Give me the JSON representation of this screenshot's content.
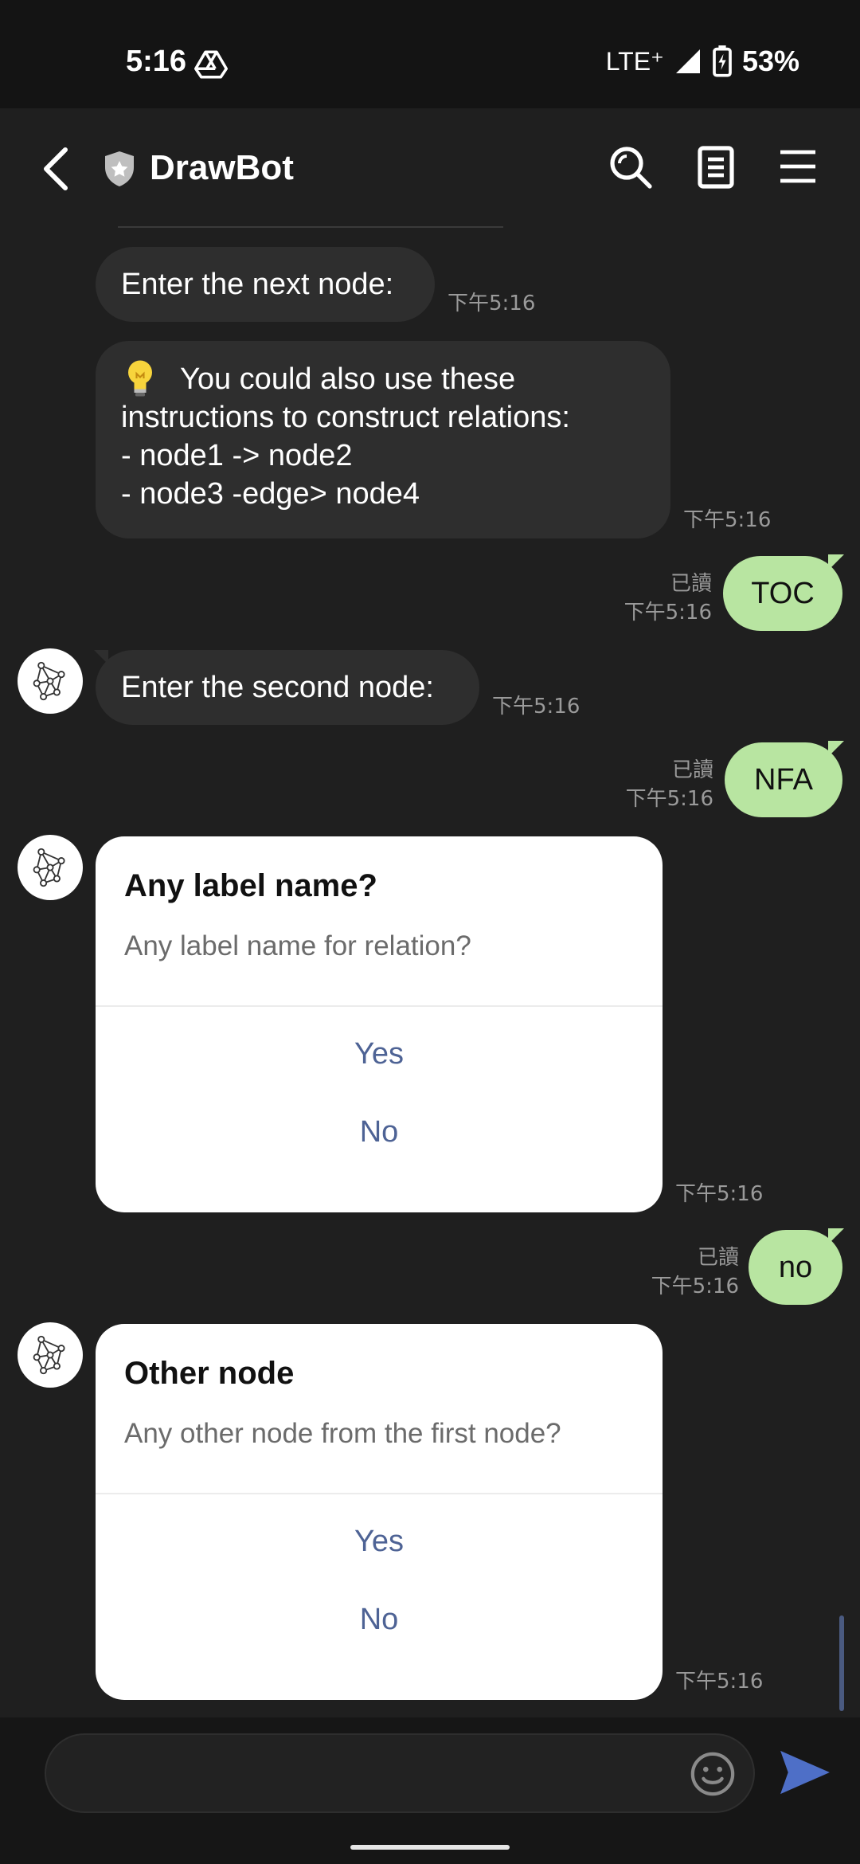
{
  "status_bar": {
    "time": "5:16",
    "network": "LTE⁺",
    "battery": "53%",
    "icons": [
      "drive-icon",
      "signal-icon",
      "battery-charging-icon"
    ]
  },
  "header": {
    "title": "DrawBot",
    "icons": [
      "back-icon",
      "shield-icon",
      "search-icon",
      "notes-icon",
      "menu-icon"
    ]
  },
  "messages": {
    "m1": {
      "text": "Enter the next node:",
      "time": "下午5:16"
    },
    "m2": {
      "line1": "You could also use these",
      "line2": "instructions to construct relations:",
      "line3": "- node1 -> node2",
      "line4": "- node3 -edge> node4",
      "time": "下午5:16",
      "icon": "lightbulb-icon"
    },
    "m3": {
      "text": "TOC",
      "read": "已讀",
      "time": "下午5:16"
    },
    "m4": {
      "text": "Enter the second node:",
      "time": "下午5:16"
    },
    "m5": {
      "text": "NFA",
      "read": "已讀",
      "time": "下午5:16"
    },
    "card1": {
      "title": "Any label name?",
      "text": "Any label name for relation?",
      "yes": "Yes",
      "no": "No",
      "time": "下午5:16"
    },
    "m6": {
      "text": "no",
      "read": "已讀",
      "time": "下午5:16"
    },
    "card2": {
      "title": "Other node",
      "text": "Any other node from the first node?",
      "yes": "Yes",
      "no": "No",
      "time": "下午5:16"
    }
  },
  "input": {
    "placeholder": "",
    "icons": [
      "emoji-icon",
      "send-icon"
    ]
  },
  "colors": {
    "background": "#1f1f1f",
    "incoming_bubble": "#2e2e2e",
    "outgoing_bubble": "#b8e5a1",
    "card_button": "#4e6395",
    "send_accent": "#4e6fc7"
  }
}
